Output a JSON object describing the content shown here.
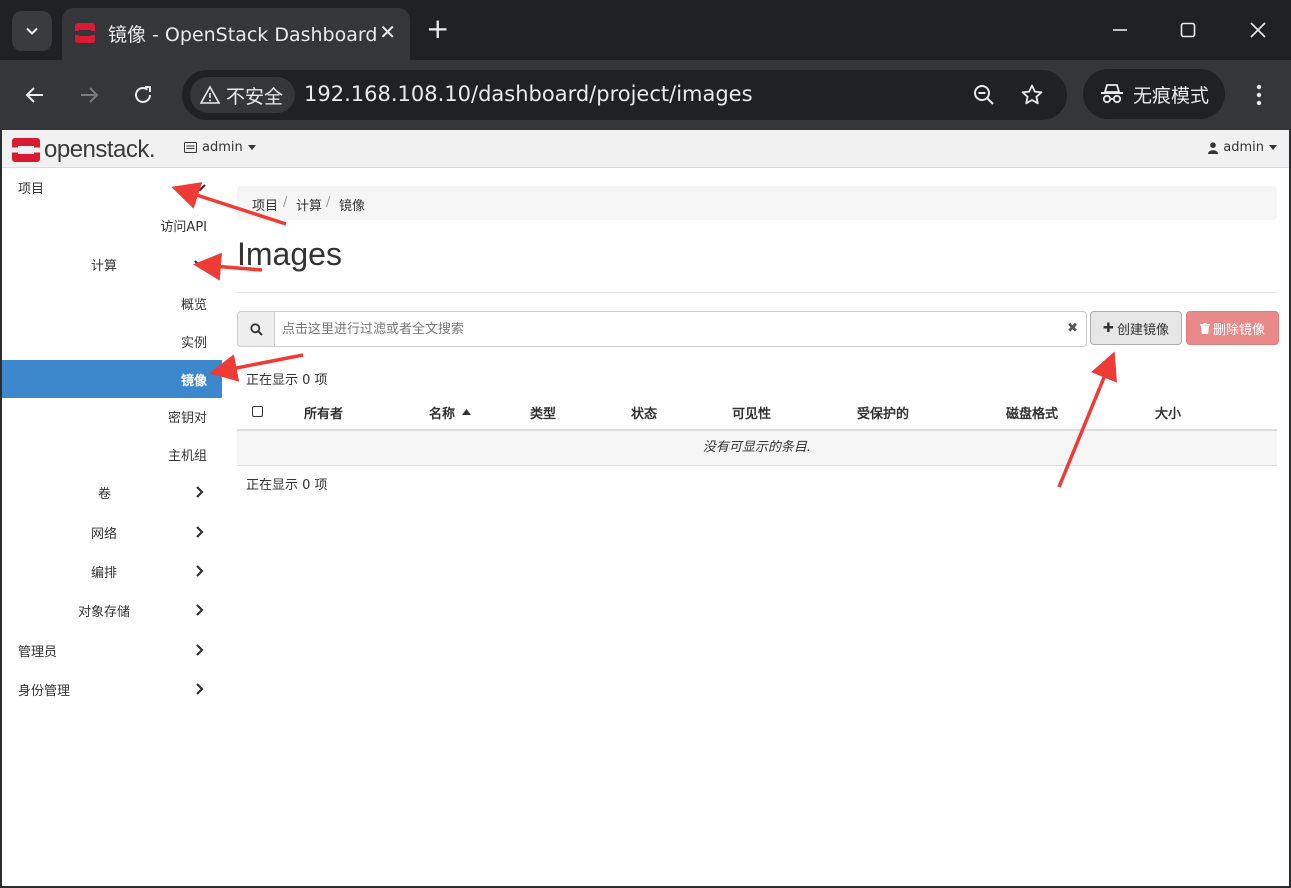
{
  "browser": {
    "tab_title": "镜像 - OpenStack Dashboard",
    "security_label": "不安全",
    "url": "192.168.108.10/dashboard/project/images",
    "incognito_label": "无痕模式"
  },
  "header": {
    "logo_text": "openstack.",
    "project_menu_label": "admin",
    "user_menu_label": "admin"
  },
  "sidebar": {
    "project": "项目",
    "api_access": "访问API",
    "compute": "计算",
    "overview": "概览",
    "instances": "实例",
    "images": "镜像",
    "key_pairs": "密钥对",
    "server_groups": "主机组",
    "volumes": "卷",
    "network": "网络",
    "orchestration": "编排",
    "object_store": "对象存储",
    "admin": "管理员",
    "identity": "身份管理"
  },
  "breadcrumb": {
    "level1": "项目",
    "level2": "计算",
    "level3": "镜像",
    "separator": "/"
  },
  "page": {
    "title": "Images",
    "filter_placeholder": "点击这里进行过滤或者全文搜索",
    "create_button": "创建镜像",
    "delete_button": "删除镜像",
    "showing_count": "正在显示 0 项",
    "empty_message": "没有可显示的条目."
  },
  "table": {
    "columns": {
      "owner": "所有者",
      "name": "名称",
      "type": "类型",
      "status": "状态",
      "visibility": "可见性",
      "protected": "受保护的",
      "disk_format": "磁盘格式",
      "size": "大小"
    }
  },
  "colors": {
    "active_nav": "#3d87cc",
    "danger": "#e8898a",
    "annotation_arrow": "#ef3b36",
    "brand_red": "#da1a32"
  }
}
